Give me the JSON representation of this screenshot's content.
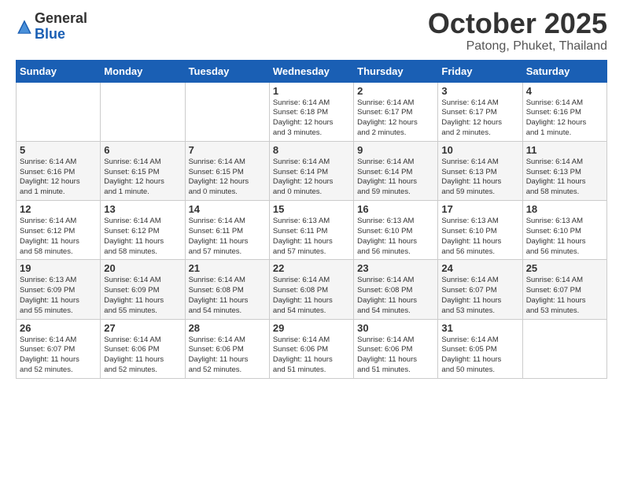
{
  "logo": {
    "general": "General",
    "blue": "Blue"
  },
  "header": {
    "month": "October 2025",
    "location": "Patong, Phuket, Thailand"
  },
  "days_of_week": [
    "Sunday",
    "Monday",
    "Tuesday",
    "Wednesday",
    "Thursday",
    "Friday",
    "Saturday"
  ],
  "weeks": [
    [
      {
        "day": "",
        "info": ""
      },
      {
        "day": "",
        "info": ""
      },
      {
        "day": "",
        "info": ""
      },
      {
        "day": "1",
        "info": "Sunrise: 6:14 AM\nSunset: 6:18 PM\nDaylight: 12 hours\nand 3 minutes."
      },
      {
        "day": "2",
        "info": "Sunrise: 6:14 AM\nSunset: 6:17 PM\nDaylight: 12 hours\nand 2 minutes."
      },
      {
        "day": "3",
        "info": "Sunrise: 6:14 AM\nSunset: 6:17 PM\nDaylight: 12 hours\nand 2 minutes."
      },
      {
        "day": "4",
        "info": "Sunrise: 6:14 AM\nSunset: 6:16 PM\nDaylight: 12 hours\nand 1 minute."
      }
    ],
    [
      {
        "day": "5",
        "info": "Sunrise: 6:14 AM\nSunset: 6:16 PM\nDaylight: 12 hours\nand 1 minute."
      },
      {
        "day": "6",
        "info": "Sunrise: 6:14 AM\nSunset: 6:15 PM\nDaylight: 12 hours\nand 1 minute."
      },
      {
        "day": "7",
        "info": "Sunrise: 6:14 AM\nSunset: 6:15 PM\nDaylight: 12 hours\nand 0 minutes."
      },
      {
        "day": "8",
        "info": "Sunrise: 6:14 AM\nSunset: 6:14 PM\nDaylight: 12 hours\nand 0 minutes."
      },
      {
        "day": "9",
        "info": "Sunrise: 6:14 AM\nSunset: 6:14 PM\nDaylight: 11 hours\nand 59 minutes."
      },
      {
        "day": "10",
        "info": "Sunrise: 6:14 AM\nSunset: 6:13 PM\nDaylight: 11 hours\nand 59 minutes."
      },
      {
        "day": "11",
        "info": "Sunrise: 6:14 AM\nSunset: 6:13 PM\nDaylight: 11 hours\nand 58 minutes."
      }
    ],
    [
      {
        "day": "12",
        "info": "Sunrise: 6:14 AM\nSunset: 6:12 PM\nDaylight: 11 hours\nand 58 minutes."
      },
      {
        "day": "13",
        "info": "Sunrise: 6:14 AM\nSunset: 6:12 PM\nDaylight: 11 hours\nand 58 minutes."
      },
      {
        "day": "14",
        "info": "Sunrise: 6:14 AM\nSunset: 6:11 PM\nDaylight: 11 hours\nand 57 minutes."
      },
      {
        "day": "15",
        "info": "Sunrise: 6:13 AM\nSunset: 6:11 PM\nDaylight: 11 hours\nand 57 minutes."
      },
      {
        "day": "16",
        "info": "Sunrise: 6:13 AM\nSunset: 6:10 PM\nDaylight: 11 hours\nand 56 minutes."
      },
      {
        "day": "17",
        "info": "Sunrise: 6:13 AM\nSunset: 6:10 PM\nDaylight: 11 hours\nand 56 minutes."
      },
      {
        "day": "18",
        "info": "Sunrise: 6:13 AM\nSunset: 6:10 PM\nDaylight: 11 hours\nand 56 minutes."
      }
    ],
    [
      {
        "day": "19",
        "info": "Sunrise: 6:13 AM\nSunset: 6:09 PM\nDaylight: 11 hours\nand 55 minutes."
      },
      {
        "day": "20",
        "info": "Sunrise: 6:14 AM\nSunset: 6:09 PM\nDaylight: 11 hours\nand 55 minutes."
      },
      {
        "day": "21",
        "info": "Sunrise: 6:14 AM\nSunset: 6:08 PM\nDaylight: 11 hours\nand 54 minutes."
      },
      {
        "day": "22",
        "info": "Sunrise: 6:14 AM\nSunset: 6:08 PM\nDaylight: 11 hours\nand 54 minutes."
      },
      {
        "day": "23",
        "info": "Sunrise: 6:14 AM\nSunset: 6:08 PM\nDaylight: 11 hours\nand 54 minutes."
      },
      {
        "day": "24",
        "info": "Sunrise: 6:14 AM\nSunset: 6:07 PM\nDaylight: 11 hours\nand 53 minutes."
      },
      {
        "day": "25",
        "info": "Sunrise: 6:14 AM\nSunset: 6:07 PM\nDaylight: 11 hours\nand 53 minutes."
      }
    ],
    [
      {
        "day": "26",
        "info": "Sunrise: 6:14 AM\nSunset: 6:07 PM\nDaylight: 11 hours\nand 52 minutes."
      },
      {
        "day": "27",
        "info": "Sunrise: 6:14 AM\nSunset: 6:06 PM\nDaylight: 11 hours\nand 52 minutes."
      },
      {
        "day": "28",
        "info": "Sunrise: 6:14 AM\nSunset: 6:06 PM\nDaylight: 11 hours\nand 52 minutes."
      },
      {
        "day": "29",
        "info": "Sunrise: 6:14 AM\nSunset: 6:06 PM\nDaylight: 11 hours\nand 51 minutes."
      },
      {
        "day": "30",
        "info": "Sunrise: 6:14 AM\nSunset: 6:06 PM\nDaylight: 11 hours\nand 51 minutes."
      },
      {
        "day": "31",
        "info": "Sunrise: 6:14 AM\nSunset: 6:05 PM\nDaylight: 11 hours\nand 50 minutes."
      },
      {
        "day": "",
        "info": ""
      }
    ]
  ]
}
